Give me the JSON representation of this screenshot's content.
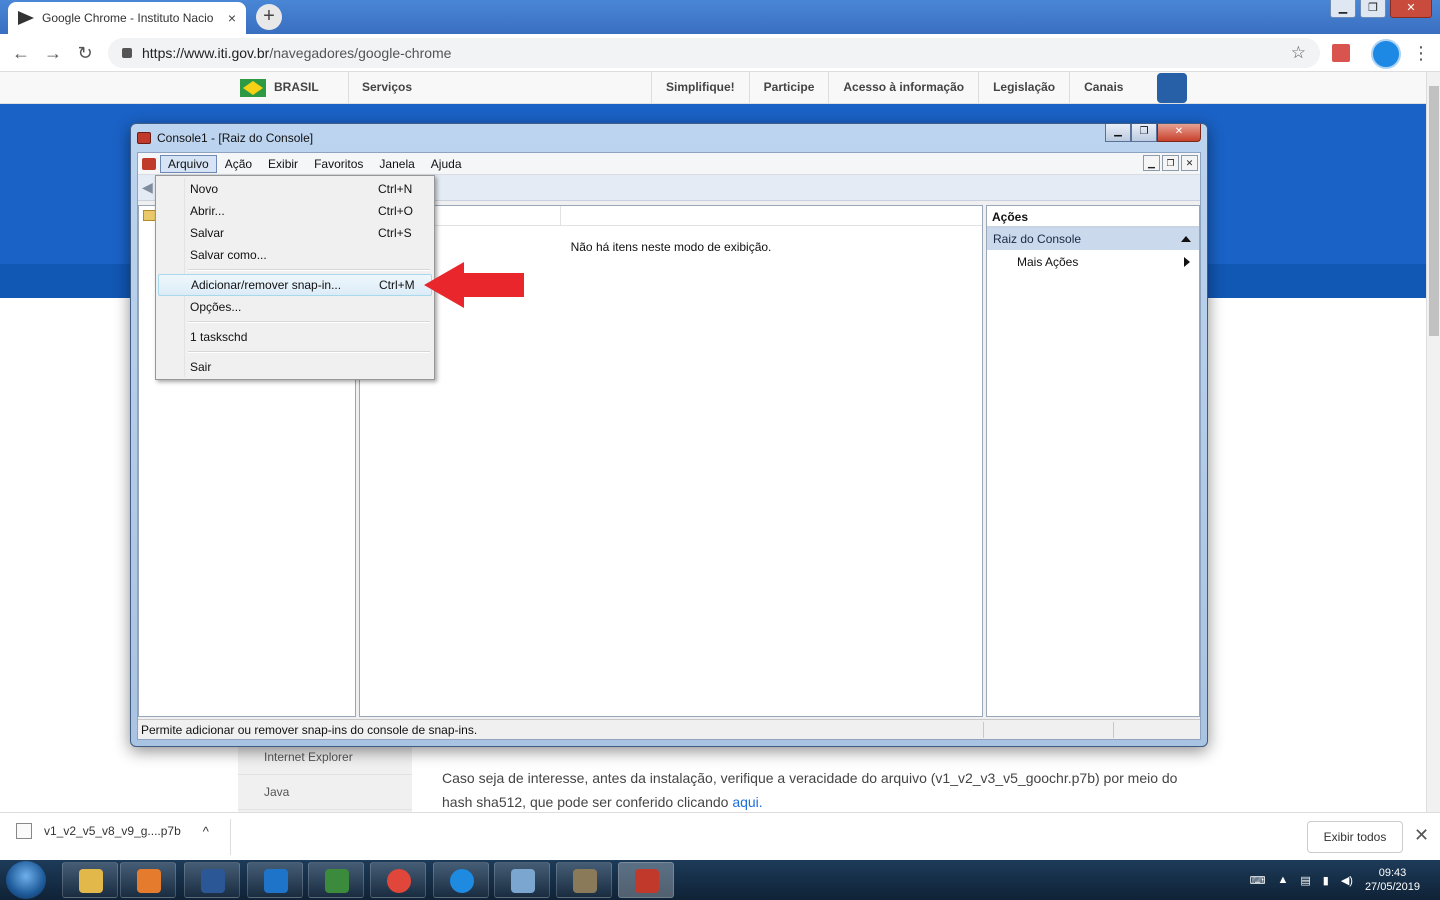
{
  "browser": {
    "tab_title": "Google Chrome - Instituto Nacio",
    "tab_close": "×",
    "new_tab": "+",
    "window_controls": [
      "▁",
      "❐",
      "✕"
    ],
    "url_domain": "https://www.iti.gov.br",
    "url_path": "/navegadores/google-chrome",
    "nav": {
      "back": "←",
      "forward": "→",
      "reload": "↻"
    },
    "star": "☆",
    "menu": "⋮"
  },
  "govbar": {
    "brasil": "BRASIL",
    "servicos": "Serviços",
    "links": [
      "Simplifique!",
      "Participe",
      "Acesso à informação",
      "Legislação",
      "Canais"
    ]
  },
  "website": {
    "sidenav": [
      "Internet Explorer",
      "Java"
    ],
    "paragraph": "Caso seja de interesse, antes da instalação, verifique a veracidade do arquivo (v1_v2_v3_v5_goochr.p7b) por meio do hash sha512, que pode ser conferido clicando ",
    "link": "aqui."
  },
  "downloads": {
    "file": "v1_v2_v5_v8_v9_g....p7b",
    "chevron": "^",
    "show_all": "Exibir todos",
    "close": "✕"
  },
  "taskbar": {
    "time": "09:43",
    "date": "27/05/2019",
    "colors": {
      "explorer": "#e2b84b",
      "media": "#e57b2c",
      "word": "#2b5797",
      "outlook": "#1e74c8",
      "vnc": "#3c8a3c",
      "chrome": "#e0463a",
      "teamviewer": "#1e8ae0",
      "notes": "#7aa6d0",
      "gimp": "#8a7a5a",
      "mmc": "#c0392b"
    }
  },
  "mmc": {
    "title": "Console1 - [Raiz do Console]",
    "window_controls": [
      "▁",
      "❐",
      "✕"
    ],
    "child_controls": [
      "▁",
      "❐",
      "✕"
    ],
    "menu": [
      "Arquivo",
      "Ação",
      "Exibir",
      "Favoritos",
      "Janela",
      "Ajuda"
    ],
    "back_arrow": "◀",
    "empty_message": "Não há itens neste modo de exibição.",
    "actions_header": "Ações",
    "actions_selected": "Raiz do Console",
    "actions_more": "Mais Ações",
    "status": "Permite adicionar ou remover snap-ins do console de snap-ins."
  },
  "file_menu": {
    "items": [
      {
        "label": "Novo",
        "shortcut": "Ctrl+N"
      },
      {
        "label": "Abrir...",
        "shortcut": "Ctrl+O"
      },
      {
        "label": "Salvar",
        "shortcut": "Ctrl+S"
      },
      {
        "label": "Salvar como...",
        "shortcut": ""
      },
      {
        "label": "Adicionar/remover snap-in...",
        "shortcut": "Ctrl+M"
      },
      {
        "label": "Opções...",
        "shortcut": ""
      },
      {
        "label": "1 taskschd",
        "shortcut": ""
      },
      {
        "label": "Sair",
        "shortcut": ""
      }
    ]
  },
  "accent": {
    "arrow": "#e8262b",
    "gov_blue": "#1a62c6"
  }
}
